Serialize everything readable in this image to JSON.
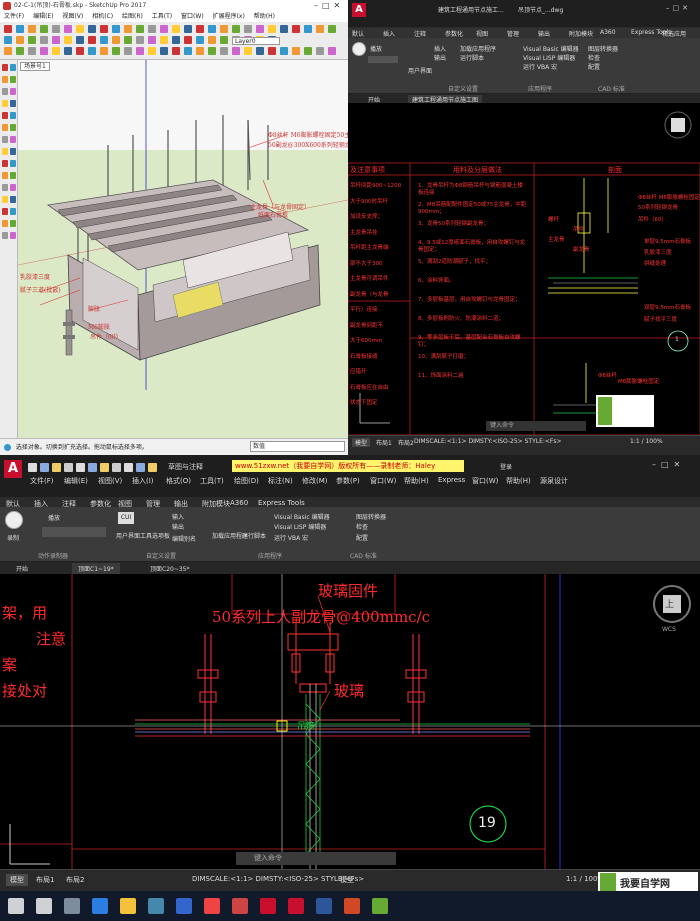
{
  "sketchup": {
    "title": "02-C-1(吊顶)-石膏板.skp - SketchUp Pro 2017",
    "menu": [
      "文件(F)",
      "编辑(E)",
      "视图(V)",
      "相机(C)",
      "绘图(R)",
      "工具(T)",
      "窗口(W)",
      "扩展程序(x)",
      "帮助(H)"
    ],
    "layer_label": "Layer0",
    "scene_tab": "场景号1",
    "annotations": {
      "hanger": "Φ8丝杆 M6膨胀螺栓固定50主龙骨",
      "keel": "50副龙@300X600系列轻钢龙骨",
      "main_keel": "主龙骨（与龙骨固定）",
      "paper": "纸面石膏板",
      "putty_left": "乳胶漆三度",
      "layers_left": "腻子三道(批嵌)",
      "bolt": "膨胀",
      "bolt2": "M6膨胀",
      "bolt3": "吊件（60）"
    },
    "status_text": "选择对象。切换到扩充选择。拖动鼠标选择多项。",
    "measure_label": "数值"
  },
  "autocad_small": {
    "title_tabs": [
      "建筑工程通用节点施工...",
      "吊顶节点_...dwg"
    ],
    "ribbon_tabs": [
      "默认",
      "插入",
      "注释",
      "参数化",
      "视图",
      "管理",
      "输出",
      "附加模块",
      "A360",
      "Express Tools",
      "精选应用"
    ],
    "ribbon_items": [
      "播放",
      "插入",
      "输出",
      "用户界面",
      "工具选项板",
      "编辑别名",
      "加载应用程序",
      "运行脚本",
      "Visual Basic 编辑器",
      "Visual LISP 编辑器",
      "运行 VBA 宏",
      "图层转换器",
      "检查",
      "配置",
      "CAD 标准"
    ],
    "panels": [
      "自定义设置",
      "应用程序",
      "CAD 标准"
    ],
    "doc_tabs": [
      "开始",
      "建筑工程通用节点施工图"
    ],
    "headers": [
      "及注意事项",
      "用料及分层做法",
      "剖面"
    ],
    "middle_text": [
      "1、龙骨吊杆为Φ8钢筋吊杆与钢筋混凝土楼板连接",
      "2、M8吊筋配配件固定50或75主龙骨，中距900mm；",
      "3、龙骨50系列轻钢副龙骨；",
      "4、9.5或12厚纸面石膏板，用自攻螺钉与龙骨固定；",
      "5、满刮2道防潮腻子，找平；",
      "6、涂料饰面。",
      "7、多层板基层，用自攻螺钉与龙骨固定；",
      "8、多层板刷防火、防潮涂料二道；",
      "9、等多层板干后，基层配合石膏板自攻螺钉；",
      "10、满刮腻子打磨；",
      "11、饰面涂料二遍"
    ],
    "left_text": [
      "吊杆间距900~1200",
      "大于900时吊杆",
      "加设反支撑；",
      "主龙骨吊挂",
      "吊杆距主龙骨端",
      "部不大于300",
      "主龙骨可调吊件",
      "副龙骨（与龙骨",
      "平行）连接",
      "副龙骨间距不",
      "大于600mm",
      "石膏板接缝",
      "应错开",
      "石膏板应在自由",
      "状态下固定"
    ],
    "right_text": [
      "Φ8丝杆 M6膨胀螺栓固定50主龙骨",
      "50系列轻钢龙骨",
      "吊件（60）",
      "单层9.5mm石膏板",
      "乳胶漆三度",
      "拼缝处理",
      "双层9.5mm石膏板",
      "腻子找平三度",
      "M6膨胀螺栓固定",
      "Φ8丝杆"
    ],
    "mid_callouts": [
      "螺杆",
      "吊件",
      "主龙骨",
      "副龙骨"
    ],
    "circle_number": "1",
    "command": "键入命令",
    "model_tabs": [
      "模型",
      "布局1",
      "布局2"
    ],
    "zoom": "1:1 / 100%",
    "status_text": "DIMSCALE:<1:1> DIMSTY:<ISO-25> STYLE:<Fs>"
  },
  "autocad_big": {
    "quick_tabs": [
      "草图与注释"
    ],
    "banner": "www.51zxw.net（我要自学网）版权所有——录制老师：Haley",
    "login": "登录",
    "menu": [
      "文件(F)",
      "编辑(E)",
      "视图(V)",
      "插入(I)",
      "格式(O)",
      "工具(T)",
      "绘图(D)",
      "标注(N)",
      "修改(M)",
      "参数(P)",
      "窗口(W)",
      "帮助(H)",
      "Express",
      "窗口(W)",
      "帮助(H)",
      "源泉设计"
    ],
    "ribbon_tabs": [
      "默认",
      "插入",
      "注释",
      "参数化",
      "视图",
      "管理",
      "输出",
      "附加模块",
      "A360",
      "Express Tools"
    ],
    "record_label": "录制",
    "play_label": "播放",
    "cui": "CUI",
    "ui_labels": [
      "用户界面",
      "工具选项板",
      "编辑别名",
      "输入",
      "输出"
    ],
    "app_labels": [
      "加载应用程序",
      "运行脚本",
      "Visual Basic 编辑器",
      "Visual LISP 编辑器",
      "运行 VBA 宏"
    ],
    "std_labels": [
      "图层转换器",
      "检查",
      "配置"
    ],
    "panels": [
      "动作录制器",
      "自定义设置",
      "应用程序",
      "CAD 标准"
    ],
    "doc_tabs": [
      "开始",
      "顶面C1~19*",
      "顶面C20~35*"
    ],
    "drawing": {
      "title_glass": "玻璃固件",
      "keel": "50系列上人副龙骨@400mmc/c",
      "glass": "玻璃",
      "dims": "吊筋",
      "left_text": [
        "架，用",
        "注意",
        "案",
        "接处对"
      ],
      "circle_number": "19",
      "wcs": "WCS",
      "viewcube": "上"
    },
    "command": "键入命令",
    "model_tabs": [
      "模型",
      "布局1",
      "布局2"
    ],
    "status_text": "DIMSCALE:<1:1> DIMSTY:<ISO-25> STYLE:<Fs>",
    "model_btn": "模型",
    "zoom": "1:1 / 100%",
    "watermark": "我要自学网"
  },
  "taskbar": {
    "apps": [
      "start",
      "search",
      "taskview",
      "edge",
      "explorer",
      "store",
      "mail",
      "chrome",
      "sketchup",
      "autocad",
      "autocad2",
      "word",
      "ppt",
      "record"
    ]
  }
}
